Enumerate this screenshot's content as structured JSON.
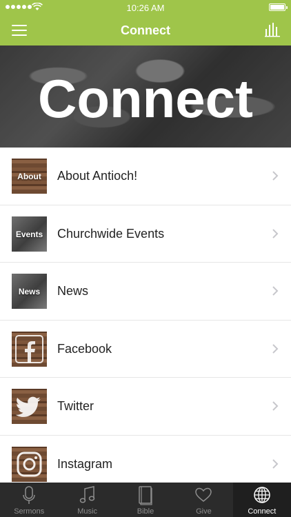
{
  "status_bar": {
    "time": "10:26 AM"
  },
  "nav": {
    "title": "Connect"
  },
  "hero": {
    "text": "Connect"
  },
  "items": [
    {
      "label": "About Antioch!",
      "thumb_label": "About",
      "thumb_style": "wood"
    },
    {
      "label": "Churchwide Events",
      "thumb_label": "Events",
      "thumb_style": "gray"
    },
    {
      "label": "News",
      "thumb_label": "News",
      "thumb_style": "gray"
    },
    {
      "label": "Facebook",
      "thumb_label": "",
      "thumb_style": "wood",
      "icon": "facebook-icon"
    },
    {
      "label": "Twitter",
      "thumb_label": "",
      "thumb_style": "wood",
      "icon": "twitter-bird-icon"
    },
    {
      "label": "Instagram",
      "thumb_label": "",
      "thumb_style": "wood",
      "icon": "instagram-icon"
    }
  ],
  "tabs": [
    {
      "label": "Sermons",
      "icon": "microphone-icon",
      "active": false
    },
    {
      "label": "Music",
      "icon": "music-note-icon",
      "active": false
    },
    {
      "label": "Bible",
      "icon": "book-icon",
      "active": false
    },
    {
      "label": "Give",
      "icon": "heart-icon",
      "active": false
    },
    {
      "label": "Connect",
      "icon": "globe-icon",
      "active": true
    }
  ],
  "colors": {
    "brand": "#9fc54a",
    "tabbar": "#2b2b2b"
  }
}
